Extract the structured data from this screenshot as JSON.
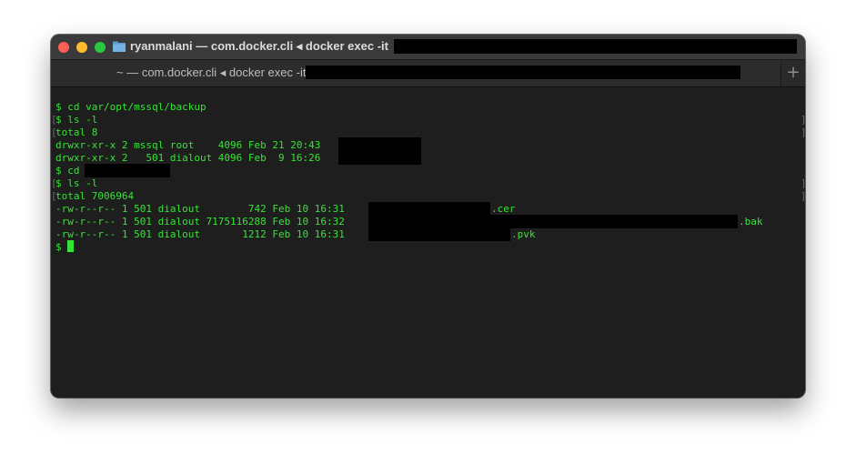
{
  "window": {
    "title": "ryanmalani — com.docker.cli ◂ docker exec -it",
    "tab_label": "~ — com.docker.cli ◂ docker exec -it",
    "new_tab_symbol": "+"
  },
  "terminal": {
    "text_color": "#34e534",
    "background": "#1e1e1e",
    "lines": [
      "$ cd var/opt/mssql/backup",
      "$ ls -l",
      "total 8",
      "drwxr-xr-x 2 mssql root    4096 Feb 21 20:43",
      "drwxr-xr-x 2   501 dialout 4096 Feb  9 16:26",
      "$ cd",
      "$ ls -l",
      "total 7006964",
      "-rw-r--r-- 1 501 dialout        742 Feb 10 16:31",
      "-rw-r--r-- 1 501 dialout 7175116288 Feb 10 16:32",
      "-rw-r--r-- 1 501 dialout       1212 Feb 10 16:31",
      "$"
    ],
    "extensions": {
      "cer": ".cer",
      "bak": ".bak",
      "pvk": ".pvk"
    },
    "mark_left": "[",
    "mark_right": "]"
  }
}
